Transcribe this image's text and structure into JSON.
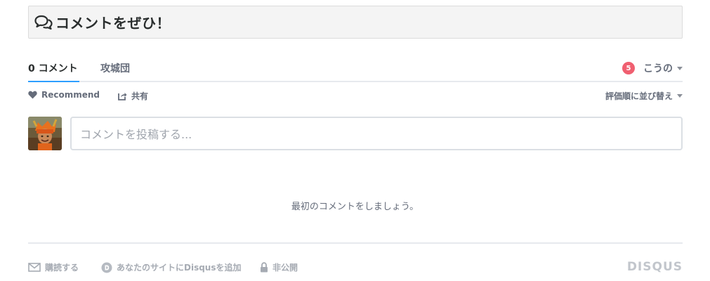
{
  "header": {
    "title": "コメントをぜひ！",
    "icon": "comments-icon"
  },
  "nav": {
    "comments_tab": "0 コメント",
    "forum_tab": "攻城団",
    "notification_count": "5",
    "user_name": "こうの"
  },
  "actions": {
    "recommend": "Recommend",
    "share": "共有",
    "sort": "評価順に並び替え"
  },
  "composer": {
    "placeholder": "コメントを投稿する..."
  },
  "empty_message": "最初のコメントをしましょう。",
  "footer": {
    "subscribe": "購読する",
    "add_disqus": "あなたのサイトにDisqusを追加",
    "privacy": "非公開",
    "brand": "DISQUS"
  },
  "colors": {
    "accent": "#2e9fff",
    "badge": "#f05f70",
    "muted": "#656c7a"
  }
}
